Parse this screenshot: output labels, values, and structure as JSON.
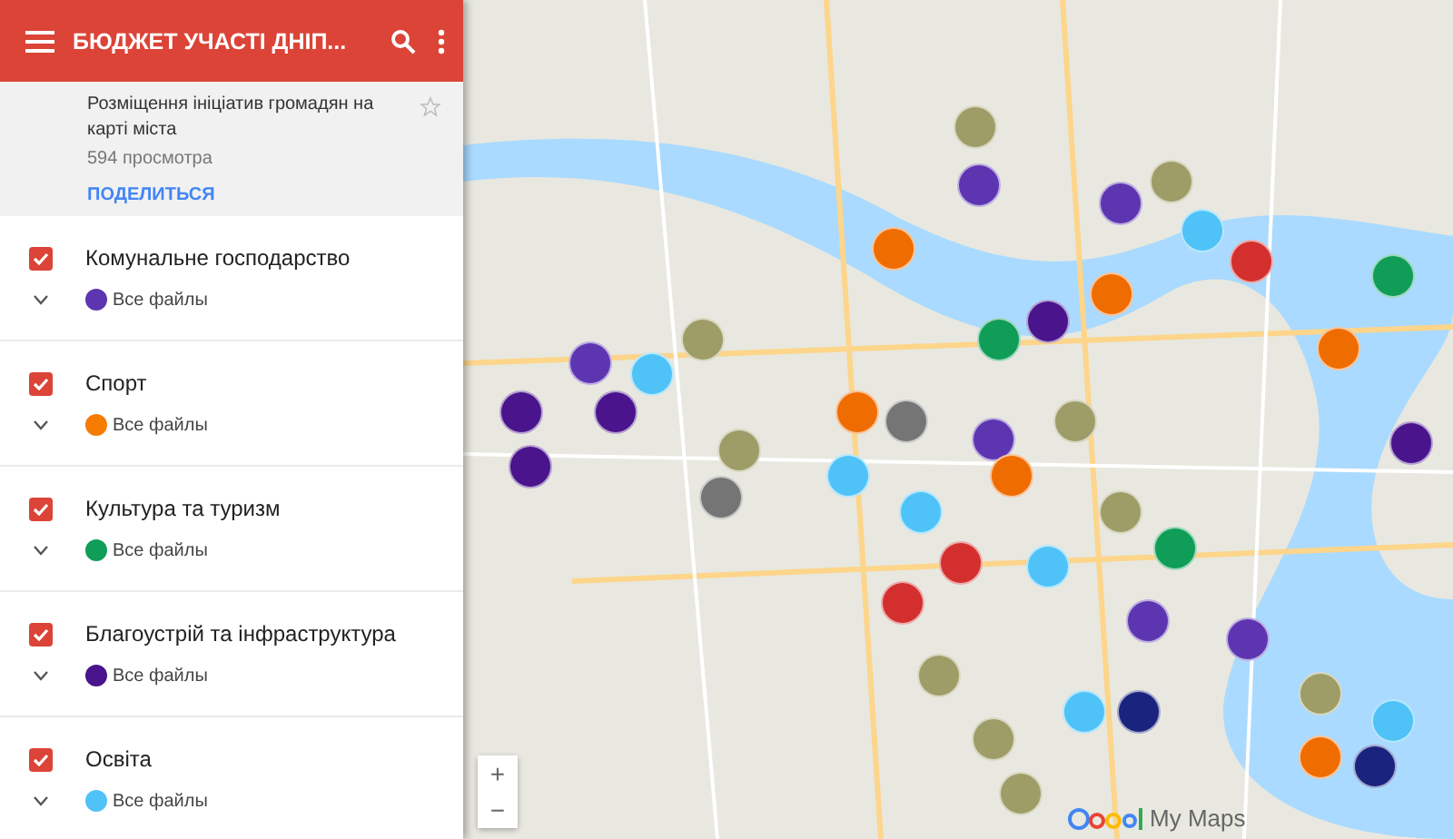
{
  "header": {
    "title": "БЮДЖЕТ УЧАСТІ ДНІП..."
  },
  "info": {
    "description": "Розміщення ініціатив громадян на карті міста",
    "views": "594 просмотра",
    "share": "ПОДЕЛИТЬСЯ",
    "starred": false
  },
  "layers": [
    {
      "name": "Комунальне господарство",
      "checked": true,
      "expanded": false,
      "files": "Все файлы",
      "color": "#5e35b1"
    },
    {
      "name": "Спорт",
      "checked": true,
      "expanded": false,
      "files": "Все файлы",
      "color": "#f57c00"
    },
    {
      "name": "Культура та туризм",
      "checked": true,
      "expanded": false,
      "files": "Все файлы",
      "color": "#0f9d58"
    },
    {
      "name": "Благоустрій та інфраструктура",
      "checked": true,
      "expanded": false,
      "files": "Все файлы",
      "color": "#4a148c"
    },
    {
      "name": "Освіта",
      "checked": true,
      "expanded": false,
      "files": "Все файлы",
      "color": "#4fc3f7"
    }
  ],
  "map": {
    "zoom_in": "+",
    "zoom_out": "−",
    "attribution": "My Maps"
  }
}
